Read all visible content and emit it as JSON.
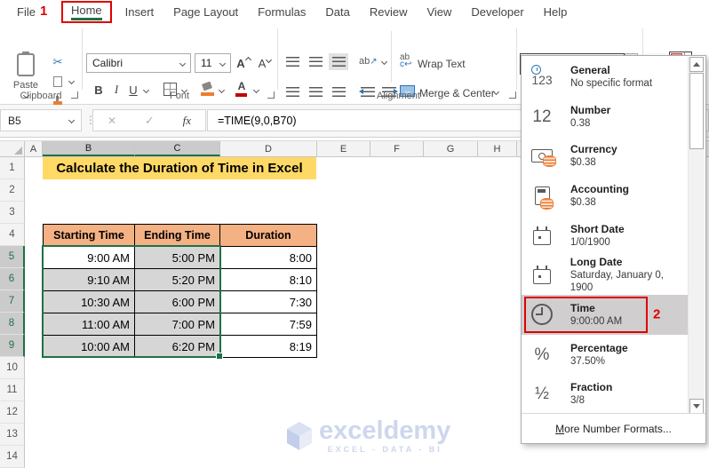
{
  "annotations": {
    "step1": "1",
    "step2": "2"
  },
  "ribbon_tabs": [
    {
      "label": "File"
    },
    {
      "label": "Home",
      "active": true,
      "annotated": true
    },
    {
      "label": "Insert"
    },
    {
      "label": "Page Layout"
    },
    {
      "label": "Formulas"
    },
    {
      "label": "Data"
    },
    {
      "label": "Review"
    },
    {
      "label": "View"
    },
    {
      "label": "Developer"
    },
    {
      "label": "Help"
    }
  ],
  "ribbon": {
    "clipboard": {
      "label": "Clipboard",
      "paste": "Paste"
    },
    "font": {
      "label": "Font",
      "name": "Calibri",
      "size": "11",
      "bold": "B",
      "italic": "I",
      "underline": "U"
    },
    "alignment": {
      "label": "Alignment",
      "wrap": "Wrap Text",
      "merge": "Merge & Center"
    },
    "number": {
      "combo_value": ""
    }
  },
  "formula_bar": {
    "name_box": "B5",
    "fx": "fx",
    "formula": "=TIME(9,0,B70)"
  },
  "sheet": {
    "title": "Calculate the Duration of Time in Excel",
    "col_headers": [
      {
        "label": "A"
      },
      {
        "label": "B",
        "selected": true
      },
      {
        "label": "C",
        "selected": true
      },
      {
        "label": "D"
      },
      {
        "label": "E"
      },
      {
        "label": "F"
      },
      {
        "label": "G"
      },
      {
        "label": "H"
      }
    ],
    "row_numbers": [
      {
        "label": "1"
      },
      {
        "label": "2"
      },
      {
        "label": "3"
      },
      {
        "label": "4"
      },
      {
        "label": "5",
        "selected": true
      },
      {
        "label": "6",
        "selected": true
      },
      {
        "label": "7",
        "selected": true
      },
      {
        "label": "8",
        "selected": true
      },
      {
        "label": "9",
        "selected": true
      },
      {
        "label": "10"
      },
      {
        "label": "11"
      },
      {
        "label": "12"
      },
      {
        "label": "13"
      },
      {
        "label": "14"
      }
    ],
    "table": {
      "headers": [
        "Starting Time",
        "Ending Time",
        "Duration"
      ],
      "rows": [
        [
          "9:00 AM",
          "5:00 PM",
          "8:00"
        ],
        [
          "9:10 AM",
          "5:20 PM",
          "8:10"
        ],
        [
          "10:30 AM",
          "6:00 PM",
          "7:30"
        ],
        [
          "11:00 AM",
          "7:00 PM",
          "7:59"
        ],
        [
          "10:00 AM",
          "6:20 PM",
          "8:19"
        ]
      ]
    },
    "active_cell": "B5",
    "watermark": {
      "brand": "exceldemy",
      "tagline": "EXCEL - DATA - BI"
    }
  },
  "format_dropdown": {
    "items": [
      {
        "name": "General",
        "sample": "No specific format",
        "icon": "general",
        "icon_text": "123"
      },
      {
        "name": "Number",
        "sample": "0.38",
        "icon": "number",
        "icon_text": "12"
      },
      {
        "name": "Currency",
        "sample": "$0.38",
        "icon": "currency"
      },
      {
        "name": "Accounting",
        "sample": "$0.38",
        "icon": "accounting"
      },
      {
        "name": "Short Date",
        "sample": "1/0/1900",
        "icon": "short-date"
      },
      {
        "name": "Long Date",
        "sample": "Saturday, January 0, 1900",
        "icon": "long-date"
      },
      {
        "name": "Time",
        "sample": "9:00:00 AM",
        "icon": "time",
        "selected": true,
        "badge": "2"
      },
      {
        "name": "Percentage",
        "sample": "37.50%",
        "icon": "percentage",
        "icon_text": "%"
      },
      {
        "name": "Fraction",
        "sample": "3/8",
        "icon": "fraction",
        "icon_text": "½"
      }
    ],
    "footer": "More Number Formats..."
  },
  "colors": {
    "excel_green": "#1E7145",
    "annotation_red": "#E10000",
    "table_header_fill": "#F4B183",
    "title_fill": "#FFD966",
    "selection_gray": "#D6D6D6",
    "dropdown_highlight": "#D0CECF",
    "watermark_blue": "#CDD7ED"
  }
}
